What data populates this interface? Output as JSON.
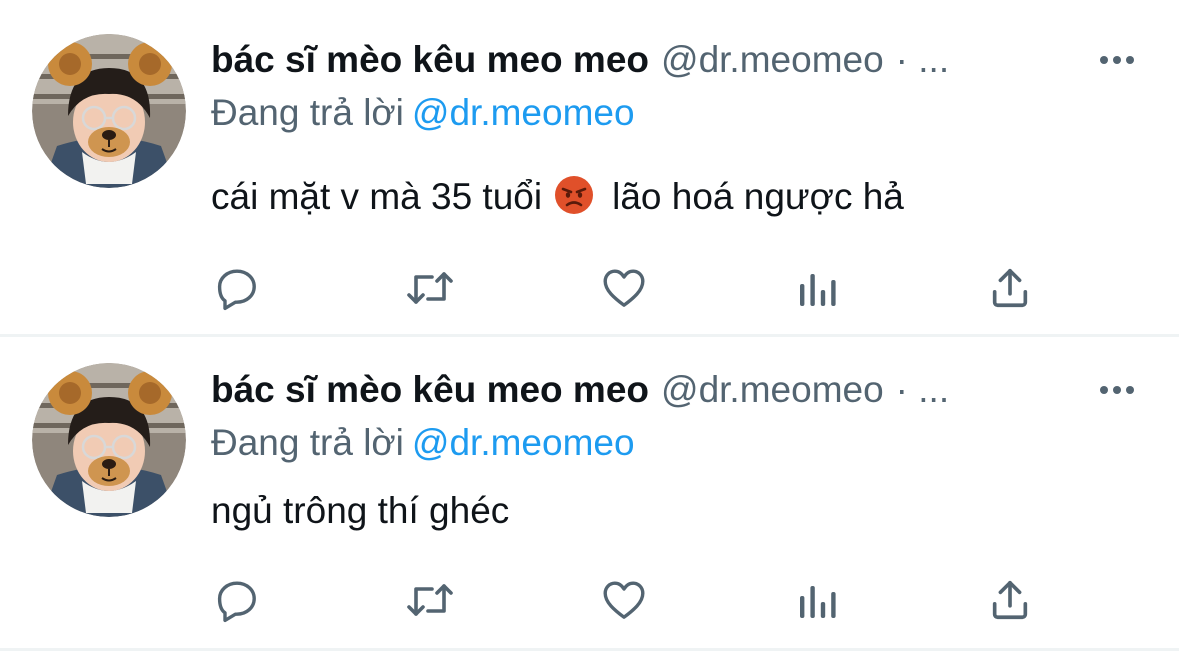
{
  "tweets": [
    {
      "display_name": "bác sĩ mèo kêu meo meo",
      "handle": "@dr.meomeo",
      "header_suffix": "· ...",
      "replying_label": "Đang trả lời",
      "replying_to": "@dr.meomeo",
      "text_before_emoji": "cái mặt v mà 35 tuổi",
      "emoji": "angry-face-emoji",
      "text_after_emoji": "lão hoá ngược hả"
    },
    {
      "display_name": "bác sĩ mèo kêu meo meo",
      "handle": "@dr.meomeo",
      "header_suffix": "· ...",
      "replying_label": "Đang trả lời",
      "replying_to": "@dr.meomeo",
      "text": "ngủ trông thí ghéc"
    }
  ],
  "icons": {
    "reply": "reply-bubble-icon",
    "retweet": "retweet-icon",
    "like": "heart-icon",
    "views": "analytics-bars-icon",
    "share": "share-upload-icon",
    "more": "more-dots-icon"
  },
  "colors": {
    "text_primary": "#0f1419",
    "text_secondary": "#536471",
    "accent_blue": "#1d9bf0",
    "icon_gray": "#536471",
    "divider": "#eff3f4",
    "emoji_red": "#e0502a"
  }
}
